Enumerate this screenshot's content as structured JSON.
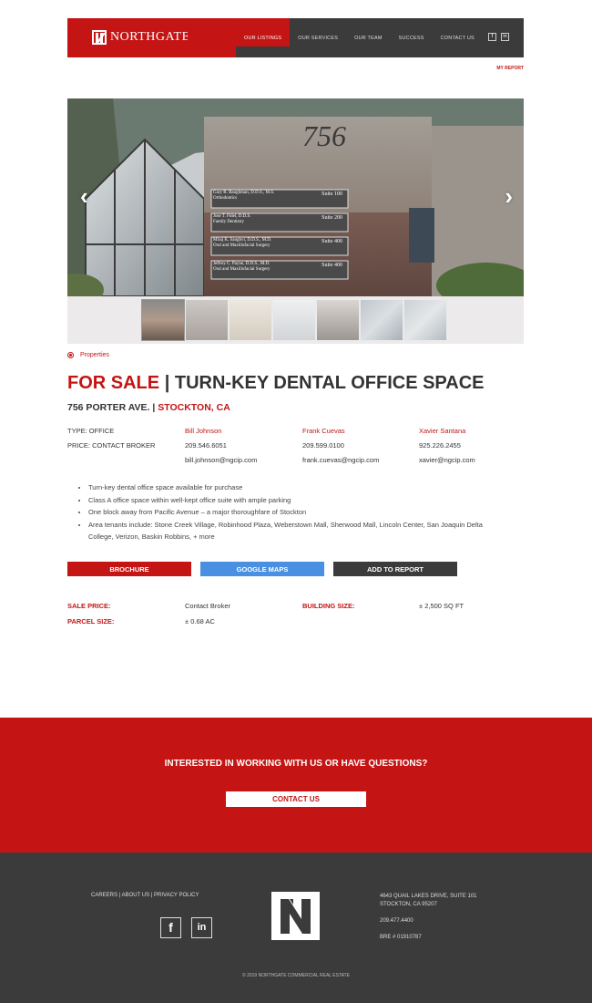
{
  "header": {
    "brand": "NORTHGATE",
    "nav": [
      "OUR LISTINGS",
      "OUR SERVICES",
      "OUR TEAM",
      "SUCCESS",
      "CONTACT US"
    ],
    "active_nav": "OUR LISTINGS",
    "social": [
      "f",
      "in"
    ],
    "my_report": "MY REPORT"
  },
  "slider": {
    "prev_icon": "chevron-left-icon",
    "next_icon": "chevron-right-icon",
    "building_number": "756",
    "signs": [
      {
        "name": "Gary R. Baughman, D.D.S., M.S.",
        "sub": "Orthodontics",
        "suite": "Suite 100"
      },
      {
        "name": "Jose T. Fidel, D.D.S.",
        "sub": "Family Dentistry",
        "suite": "Suite 200"
      },
      {
        "name": "Miraj K. Sanghvi, D.D.S., M.D.",
        "sub": "Oral and Maxillofacial Surgery",
        "suite": "Suite 400"
      },
      {
        "name": "Jeffrey C. Payne, D.D.S., M.D.",
        "sub": "Oral and Maxillofacial Surgery",
        "suite": "Suite 400"
      }
    ],
    "thumb_count": 7
  },
  "breadcrumb": "Properties",
  "listing": {
    "status": "FOR SALE",
    "separator": "|",
    "name": "TURN-KEY DENTAL OFFICE SPACE",
    "address": "756 PORTER AVE.",
    "city": "STOCKTON, CA",
    "type": "TYPE: OFFICE",
    "price": "PRICE: CONTACT BROKER",
    "brokers": [
      {
        "name": "Bill Johnson",
        "phone": "209.546.6051",
        "email": "bill.johnson@ngcip.com"
      },
      {
        "name": "Frank Cuevas",
        "phone": "209.599.0100",
        "email": "frank.cuevas@ngcip.com"
      },
      {
        "name": "Xavier Santana",
        "phone": "925.226.2455",
        "email": "xavier@ngcip.com"
      }
    ],
    "highlights": [
      "Turn-key dental office space available for purchase",
      "Class A office space within well-kept office suite  with ample parking",
      "One block away from Pacific Avenue – a major thoroughfare of Stockton",
      "Area tenants include: Stone Creek Village, Robinhood Plaza, Weberstown Mall, Sherwood Mall, Lincoln Center, San Joaquin Delta College, Verizon, Baskin Robbins, + more"
    ],
    "buttons": {
      "brochure": "BROCHURE",
      "maps": "GOOGLE MAPS",
      "report": "ADD TO REPORT"
    },
    "specs": {
      "sale_price_label": "SALE PRICE:",
      "sale_price": "Contact Broker",
      "building_size_label": "BUILDING SIZE:",
      "building_size": "± 2,500 SQ FT",
      "parcel_size_label": "PARCEL SIZE:",
      "parcel_size": "± 0.68 AC"
    }
  },
  "cta": {
    "text": "INTERESTED IN WORKING WITH US OR HAVE QUESTIONS?",
    "button": "CONTACT US"
  },
  "footer": {
    "links": "CAREERS | ABOUT US | PRIVACY POLICY",
    "social": [
      "f",
      "in"
    ],
    "address1": "4643 QUAIL LAKES DRIVE, SUITE 101",
    "address2": "STOCKTON, CA 95207",
    "phone": "209.477.4400",
    "bre": "BRE # 01910787",
    "copyright": "© 2019 NORTHGATE COMMERCIAL REAL ESTATE"
  },
  "colors": {
    "brand_red": "#c41414",
    "dark": "#3b3b3b",
    "maps_blue": "#4a90e2"
  }
}
